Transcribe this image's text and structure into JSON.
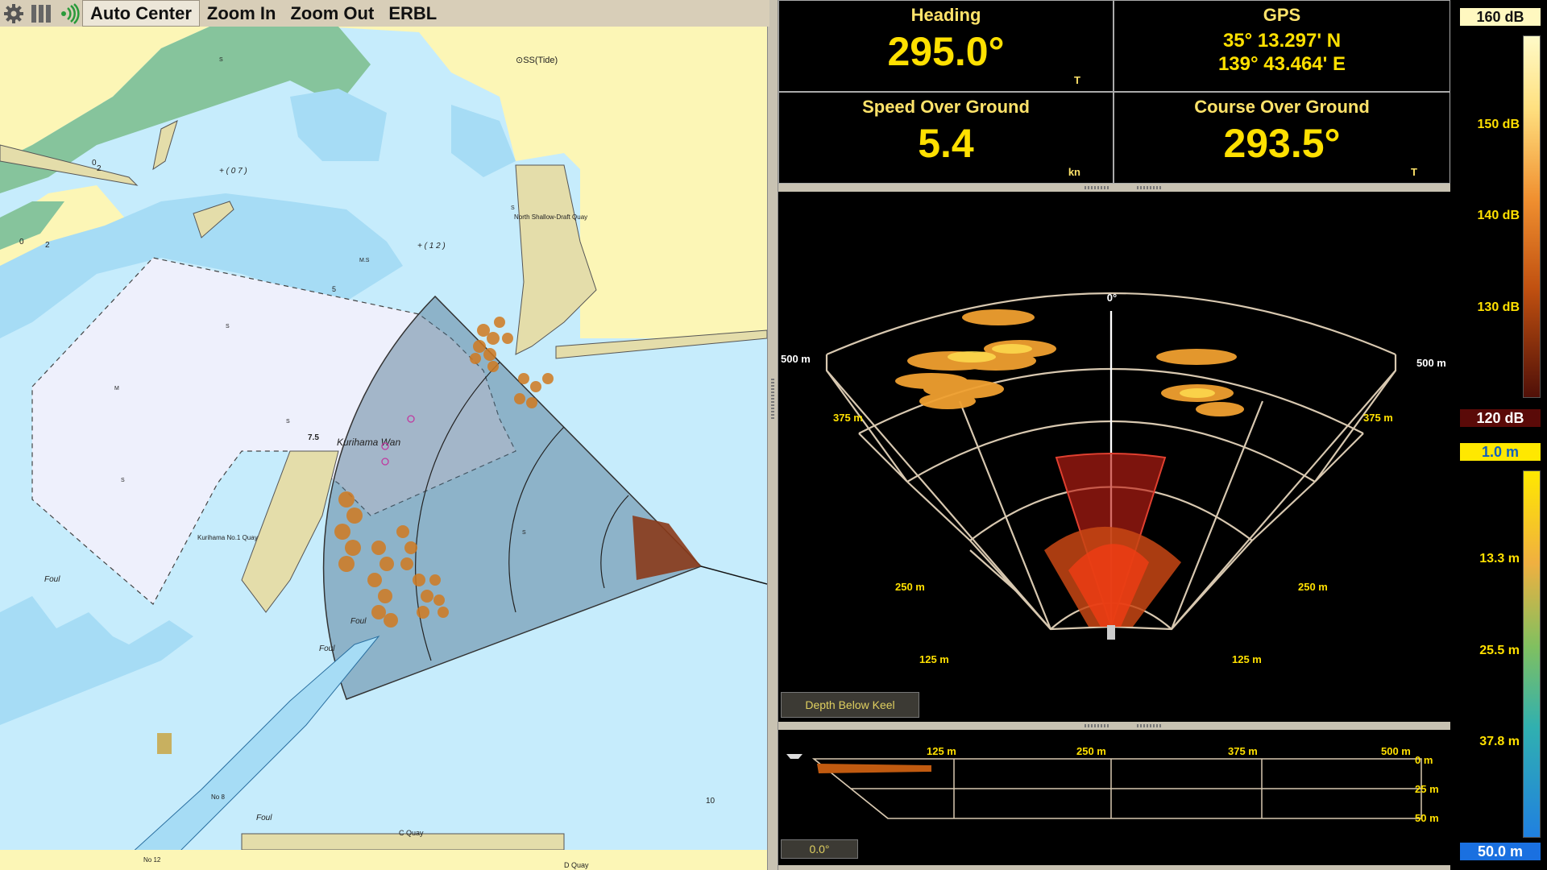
{
  "toolbar": {
    "settings_icon": "gear-icon",
    "layout_icon": "columns-icon",
    "signal_icon": "signal-icon",
    "auto_center": "Auto Center",
    "zoom_in": "Zoom In",
    "zoom_out": "Zoom Out",
    "erbl": "ERBL"
  },
  "chart_labels": {
    "tide": "⊙SS(Tide)",
    "north_quay": "North Shallow-Draft Quay",
    "bay": "Kurihama Wan",
    "quay1": "Kurihama No.1 Quay",
    "c_quay": "C Quay",
    "d_quay": "D Quay",
    "no8": "No 8",
    "no12": "No 12",
    "foul1": "Foul",
    "foul2": "Foul",
    "foul3": "Foul",
    "foul4": "Foul",
    "depth_07": "+ ( 0 7 )",
    "depth_12": "+ ( 1 2 )",
    "depth_75": "7.5",
    "depth_5": "5",
    "depth_10": "10",
    "depth_0": "0",
    "depth_2": "2",
    "depth_0b": "0",
    "depth_2b": "2",
    "ms": "M.S",
    "s1": "S",
    "s2": "S",
    "s3": "S",
    "s4": "S",
    "s5": "S",
    "s6": "S",
    "m1": "M"
  },
  "instruments": {
    "heading": {
      "title": "Heading",
      "value": "295.0°",
      "unit": "T"
    },
    "gps": {
      "title": "GPS",
      "lat": "35° 13.297' N",
      "lon": "139° 43.464' E"
    },
    "sog": {
      "title": "Speed Over Ground",
      "value": "5.4",
      "unit": "kn"
    },
    "cog": {
      "title": "Course Over Ground",
      "value": "293.5°",
      "unit": "T"
    }
  },
  "sonar3d": {
    "bearing_label": "0°",
    "ranges": [
      "125 m",
      "250 m",
      "375 m",
      "500 m"
    ],
    "depth_button": "Depth Below Keel"
  },
  "sideview": {
    "ranges": [
      "125 m",
      "250 m",
      "375 m",
      "500 m"
    ],
    "depths": [
      "0 m",
      "25 m",
      "50 m"
    ],
    "angle": "0.0°"
  },
  "scales": {
    "db_top": "160 dB",
    "db_ticks": [
      "150 dB",
      "140 dB",
      "130 dB"
    ],
    "db_bottom": "120 dB",
    "depth_top": "1.0 m",
    "depth_ticks": [
      "13.3 m",
      "25.5 m",
      "37.8 m"
    ],
    "depth_bottom": "50.0 m"
  },
  "colors": {
    "land": "#fcf6b6",
    "shallow": "#a6dcf5",
    "deep": "#c6ecfc",
    "green": "#86c49c",
    "amber": "#ffe000"
  }
}
